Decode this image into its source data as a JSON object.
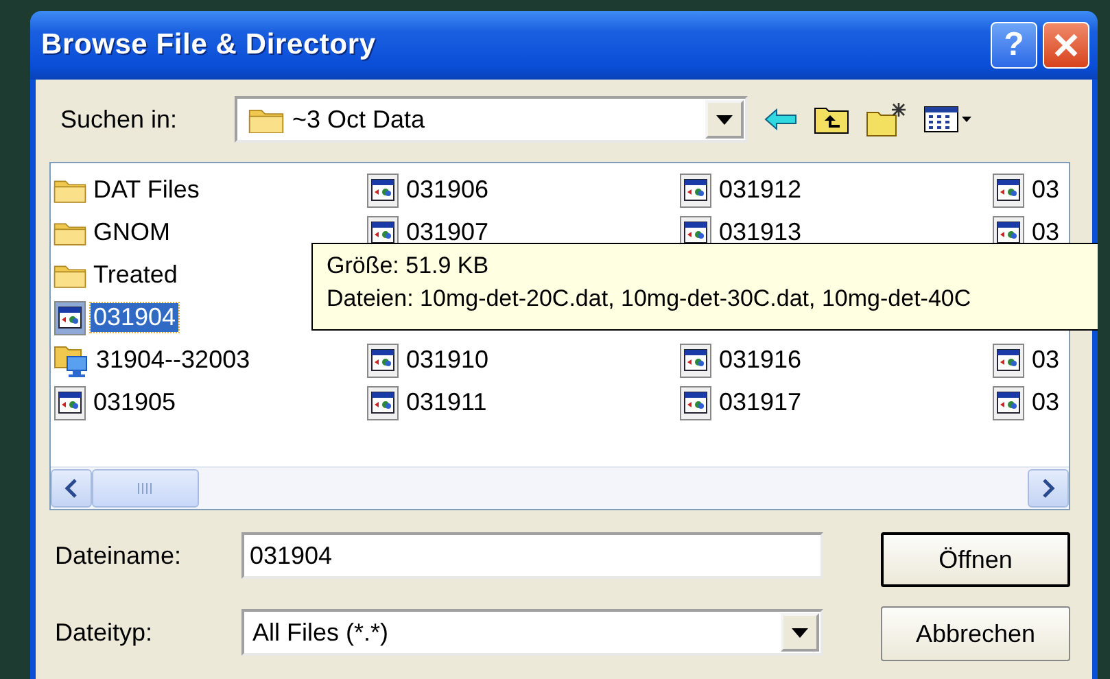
{
  "window": {
    "title": "Browse File & Directory",
    "help": "?"
  },
  "look_in": {
    "label": "Suchen in:",
    "value": "~3 Oct Data"
  },
  "columns": [
    {
      "items": [
        {
          "kind": "folder",
          "name": "DAT Files",
          "selected": false
        },
        {
          "kind": "folder",
          "name": "GNOM",
          "selected": false
        },
        {
          "kind": "folder",
          "name": "Treated",
          "selected": false
        },
        {
          "kind": "file",
          "name": "031904",
          "selected": true
        },
        {
          "kind": "linked-folder",
          "name": "31904--32003",
          "selected": false
        },
        {
          "kind": "file",
          "name": "031905",
          "selected": false
        }
      ]
    },
    {
      "items": [
        {
          "kind": "file",
          "name": "031906",
          "selected": false
        },
        {
          "kind": "file",
          "name": "031907",
          "selected": false
        },
        {
          "kind": "file",
          "name": "031910",
          "selected": false
        },
        {
          "kind": "file",
          "name": "031911",
          "selected": false
        }
      ]
    },
    {
      "items": [
        {
          "kind": "file",
          "name": "031912",
          "selected": false
        },
        {
          "kind": "file",
          "name": "031913",
          "selected": false
        },
        {
          "kind": "file",
          "name": "031916",
          "selected": false
        },
        {
          "kind": "file",
          "name": "031917",
          "selected": false
        }
      ]
    },
    {
      "items": [
        {
          "kind": "file",
          "name": "03",
          "selected": false
        },
        {
          "kind": "file",
          "name": "03",
          "selected": false
        },
        {
          "kind": "file",
          "name": "03",
          "selected": false
        },
        {
          "kind": "file",
          "name": "03",
          "selected": false
        }
      ]
    }
  ],
  "tooltip": {
    "lines": [
      "Größe: 51.9 KB",
      "Dateien: 10mg-det-20C.dat, 10mg-det-30C.dat, 10mg-det-40C"
    ]
  },
  "file_name": {
    "label": "Dateiname:",
    "value": "031904"
  },
  "file_type": {
    "label": "Dateityp:",
    "value": "All Files (*.*)"
  },
  "buttons": [
    {
      "label": "Öffnen",
      "default": true
    },
    {
      "label": "Abbrechen",
      "default": false
    }
  ]
}
